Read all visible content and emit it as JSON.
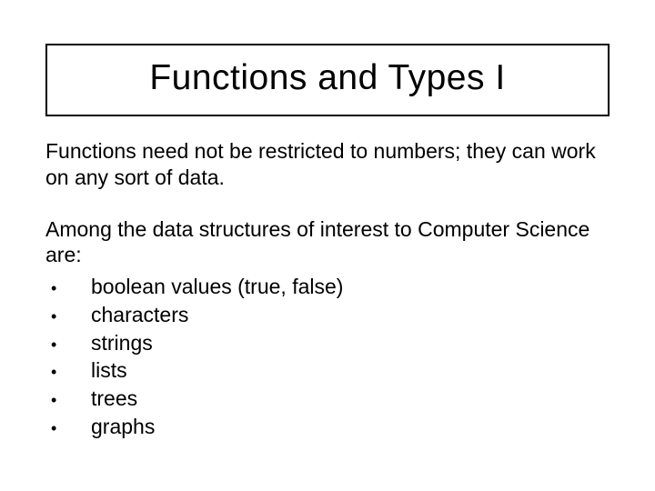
{
  "title": "Functions and Types I",
  "para1": "Functions need not be restricted to numbers; they can work on any sort of data.",
  "para2": "Among the data structures of interest to Computer Science are:",
  "bullets": [
    "boolean values (true, false)",
    "characters",
    "strings",
    "lists",
    "trees",
    "graphs"
  ]
}
